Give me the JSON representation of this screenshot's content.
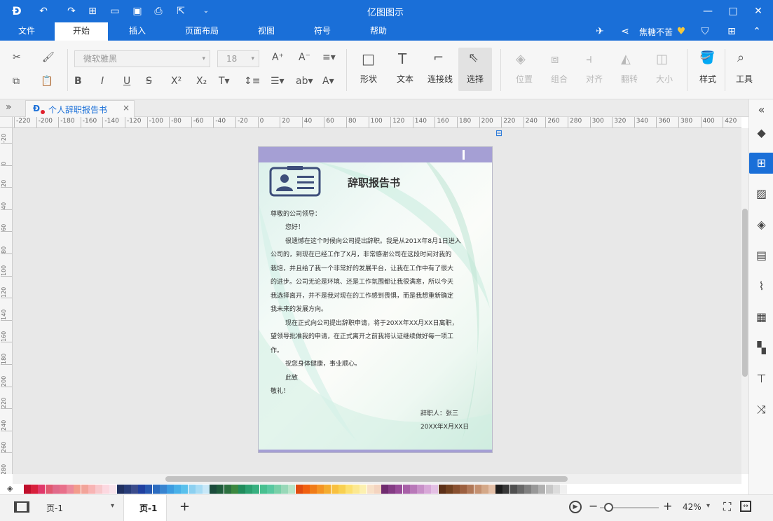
{
  "app": {
    "title": "亿图图示"
  },
  "menu": {
    "tabs": [
      {
        "label": "文件"
      },
      {
        "label": "开始"
      },
      {
        "label": "插入"
      },
      {
        "label": "页面布局"
      },
      {
        "label": "视图"
      },
      {
        "label": "符号"
      },
      {
        "label": "帮助"
      }
    ],
    "active": "开始"
  },
  "user": {
    "name": "焦糖不苦"
  },
  "toolbar": {
    "font_name": "微软雅黑",
    "font_size": "18",
    "shape_label": "形状",
    "text_label": "文本",
    "connector_label": "连接线",
    "select_label": "选择",
    "position_label": "位置",
    "group_label": "组合",
    "align_label": "对齐",
    "rotate_label": "翻转",
    "size_label": "大小",
    "style_label": "样式",
    "tools_label": "工具"
  },
  "doc_tab": {
    "label": "个人辞职报告书"
  },
  "ruler_top": [
    "-220",
    "-200",
    "-180",
    "-160",
    "-140",
    "-120",
    "-100",
    "-80",
    "-60",
    "-40",
    "-20",
    "0",
    "20",
    "40",
    "60",
    "80",
    "100",
    "120",
    "140",
    "160",
    "180",
    "200",
    "220",
    "240",
    "260",
    "280",
    "300",
    "320",
    "340",
    "360",
    "380",
    "400",
    "420"
  ],
  "ruler_left": [
    "-20",
    "0",
    "20",
    "40",
    "60",
    "80",
    "100",
    "120",
    "140",
    "160",
    "180",
    "200",
    "220",
    "240",
    "260",
    "280"
  ],
  "document": {
    "title": "辞职报告书",
    "salutation": "尊敬的公司领导：",
    "greeting": "您好！",
    "para1": [
      "很遗憾在这个时候向公司提出辞职。我是从201X年8月1日进入",
      "公司的，到现在已经工作了X月，非常感谢公司在这段时间对我的",
      "栽培，并且给了我一个非常好的发展平台，让我在工作中有了很大",
      "的进步。公司无论是环境、还是工作氛围都让我很满意，所以今天",
      "我选择离开，并不是我对现在的工作感到畏惧，而是我想重新确定",
      "我未来的发展方向。"
    ],
    "para2": [
      "现在正式向公司提出辞职申请，将于20XX年XX月XX日离职，",
      "望领导批准我的申请，在正式离开之前我将认证继续做好每一项工",
      "作。"
    ],
    "wish": "祝您身体健康，事业顺心。",
    "closing1": "此致",
    "closing2": "敬礼！",
    "signer": "辞职人：张三",
    "date": "20XX年X月XX日"
  },
  "status": {
    "page_select": "页-1",
    "page_tab": "页-1",
    "add_page": "+",
    "zoom": "42%"
  },
  "colors": {
    "accent": "#1a6fd8",
    "page_header_bar": "#a59fd4",
    "id_card_icon": "#3d4e7a"
  },
  "palette": [
    "#c0102c",
    "#d8203c",
    "#e0386a",
    "#e05870",
    "#e06a8a",
    "#e8708a",
    "#ec8a9c",
    "#f29c8c",
    "#f2a49a",
    "#f8b4b4",
    "#f8c8cc",
    "#fcd8e0",
    "#f8e4ec",
    "#203060",
    "#283c78",
    "#3c4c8c",
    "#2040a0",
    "#2858b0",
    "#2c6cc0",
    "#3884d0",
    "#3c9ce0",
    "#48b0e8",
    "#58c0ec",
    "#8cd0f0",
    "#a8dcf4",
    "#c8e8f8",
    "#1c4c3c",
    "#205c3c",
    "#2c7040",
    "#3c8840",
    "#208c5c",
    "#2ca070",
    "#38b080",
    "#48c090",
    "#58c8a0",
    "#78d0a8",
    "#98d8b8",
    "#b8e4c8",
    "#e04c10",
    "#f06010",
    "#f07c18",
    "#f49424",
    "#f4ac30",
    "#f8c040",
    "#f8d050",
    "#fce070",
    "#fce890",
    "#fcf0b0",
    "#f8e0c8",
    "#f4d4c0",
    "#702c70",
    "#843c84",
    "#984c98",
    "#a860a8",
    "#b878b8",
    "#c890c8",
    "#d8a8d8",
    "#e4c0e4",
    "#5c3018",
    "#704020",
    "#885030",
    "#9c6040",
    "#b07858",
    "#c49070",
    "#d4a888",
    "#e4c0a8",
    "#1c1c1c",
    "#383838",
    "#505050",
    "#686868",
    "#808080",
    "#989898",
    "#b0b0b0",
    "#c8c8c8",
    "#dcdcdc",
    "#f0f0f0"
  ]
}
